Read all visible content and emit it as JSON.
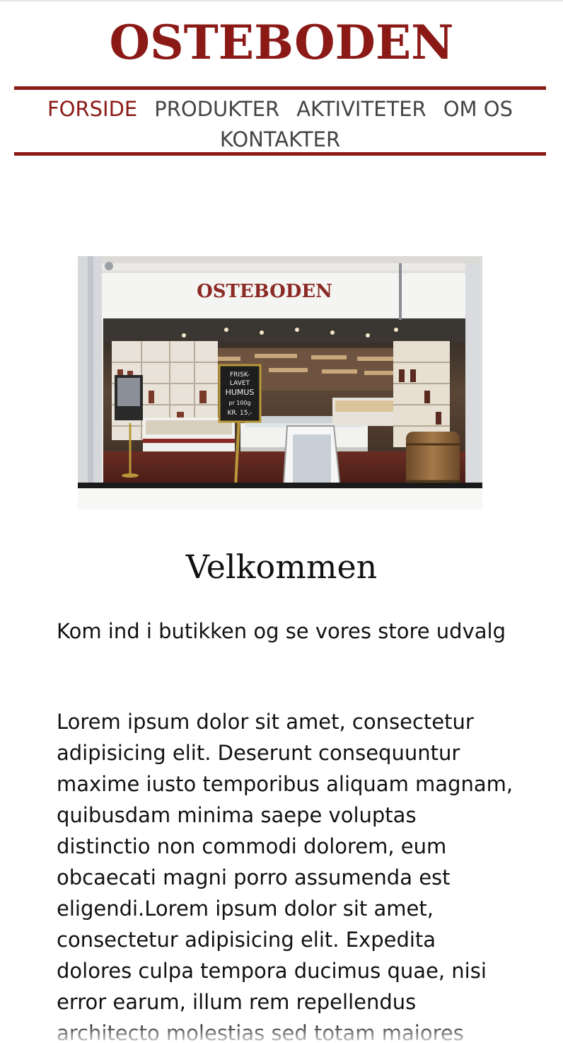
{
  "header": {
    "logo_text": "OSTEBODEN"
  },
  "nav": {
    "items": [
      {
        "label": "FORSIDE",
        "active": true
      },
      {
        "label": "PRODUKTER",
        "active": false
      },
      {
        "label": "AKTIVITETER",
        "active": false
      },
      {
        "label": "OM OS",
        "active": false
      },
      {
        "label": "KONTAKTER",
        "active": false
      }
    ]
  },
  "hero": {
    "sign_text": "OSTEBODEN",
    "chalkboard_lines": [
      "FRISK-",
      "LAVET",
      "HUMUS",
      "pr 100g",
      "KR. 15,-"
    ]
  },
  "main": {
    "heading": "Velkommen",
    "intro": "Kom ind i butikken og se vores store udvalg",
    "body": "Lorem ipsum dolor sit amet, consectetur adipisicing elit. Deserunt consequuntur maxime iusto temporibus aliquam magnam, quibusdam minima saepe voluptas distinctio non commodi dolorem, eum obcaecati magni porro assumenda est eligendi.Lorem ipsum dolor sit amet, consectetur adipisicing elit. Expedita dolores culpa tempora ducimus quae, nisi error earum, illum rem repellendus architecto molestias sed totam maiores"
  },
  "colors": {
    "brand": "#8b1a17",
    "nav_text": "#444444",
    "body_text": "#111111"
  }
}
